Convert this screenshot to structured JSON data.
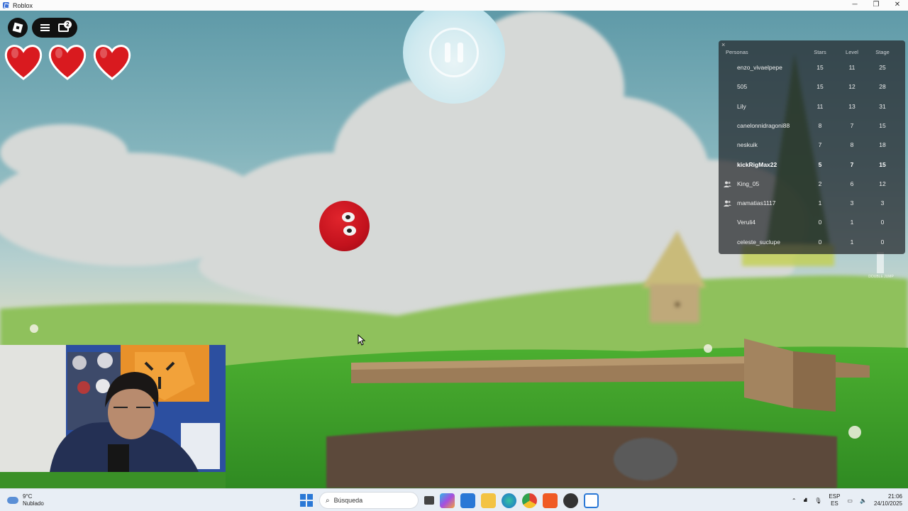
{
  "window": {
    "title": "Roblox",
    "minimize": "─",
    "maximize": "❐",
    "close": "✕"
  },
  "topbar": {
    "chat_badge": "2",
    "hearts": 3
  },
  "leaderboard": {
    "headers": {
      "name": "Personas",
      "stars": "Stars",
      "level": "Level",
      "stage": "Stage"
    },
    "close_label": "×",
    "rows": [
      {
        "name": "enzo_vivaelpepe",
        "stars": "15",
        "level": "11",
        "stage": "25",
        "friend": false,
        "me": false
      },
      {
        "name": "505",
        "stars": "15",
        "level": "12",
        "stage": "28",
        "friend": false,
        "me": false
      },
      {
        "name": "Lily",
        "stars": "11",
        "level": "13",
        "stage": "31",
        "friend": false,
        "me": false
      },
      {
        "name": "canelonnidragoni88",
        "stars": "8",
        "level": "7",
        "stage": "15",
        "friend": false,
        "me": false
      },
      {
        "name": "neskuik",
        "stars": "7",
        "level": "8",
        "stage": "18",
        "friend": false,
        "me": false
      },
      {
        "name": "kickRigMax22",
        "stars": "5",
        "level": "7",
        "stage": "15",
        "friend": false,
        "me": true
      },
      {
        "name": "King_05",
        "stars": "2",
        "level": "6",
        "stage": "12",
        "friend": true,
        "me": false
      },
      {
        "name": "mamatias1117",
        "stars": "1",
        "level": "3",
        "stage": "3",
        "friend": true,
        "me": false
      },
      {
        "name": "Veruli4",
        "stars": "0",
        "level": "1",
        "stage": "0",
        "friend": false,
        "me": false
      },
      {
        "name": "celeste_suclupe",
        "stars": "0",
        "level": "1",
        "stage": "0",
        "friend": false,
        "me": false
      }
    ]
  },
  "hud": {
    "double_jump": "DOUBLE JUMP"
  },
  "taskbar": {
    "weather_temp": "9°C",
    "weather_desc": "Nublado",
    "search_placeholder": "Búsqueda",
    "lang_top": "ESP",
    "lang_bottom": "ES",
    "time": "21:06",
    "date": "24/10/2025"
  },
  "colors": {
    "accent": "#2a78d6",
    "ball": "#c3121d",
    "grass": "#3f9b2a"
  }
}
